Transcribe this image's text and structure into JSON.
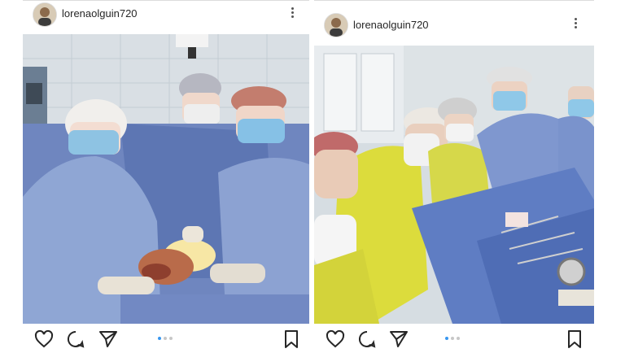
{
  "posts": [
    {
      "username": "lorenaolguin720",
      "photo_icon": "surgery-selfie-photo",
      "carousel": {
        "count": 3,
        "active": 1
      }
    },
    {
      "username": "lorenaolguin720",
      "photo_icon": "surgery-team-photo",
      "carousel": {
        "count": 3,
        "active": 1
      }
    }
  ],
  "colors": {
    "text": "#262626",
    "carousel_active": "#3897f0",
    "carousel_inactive": "#c7c7c7",
    "surgical_drape": "#5f79b8",
    "scrubs_yellow": "#d9dc3f"
  },
  "icons": [
    "avatar",
    "more-options-icon",
    "heart-icon",
    "comment-icon",
    "share-icon",
    "bookmark-icon"
  ]
}
